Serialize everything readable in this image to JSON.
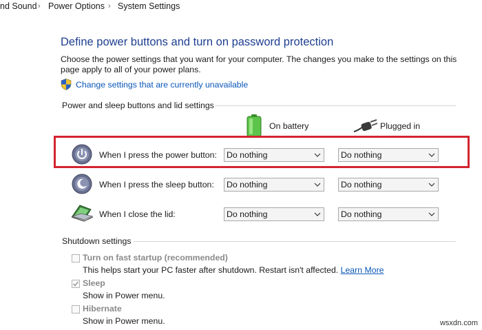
{
  "breadcrumb": {
    "item1": "nd Sound",
    "item2": "Power Options",
    "item3": "System Settings",
    "separator": "›"
  },
  "page": {
    "title": "Define power buttons and turn on password protection",
    "description": "Choose the power settings that you want for your computer. The changes you make to the settings on this page apply to all of your power plans.",
    "change_link": "Change settings that are currently unavailable"
  },
  "power_section": {
    "title": "Power and sleep buttons and lid settings",
    "col_battery": "On battery",
    "col_plugged": "Plugged in",
    "rows": [
      {
        "label": "When I press the power button:",
        "battery": "Do nothing",
        "plugged": "Do nothing"
      },
      {
        "label": "When I press the sleep button:",
        "battery": "Do nothing",
        "plugged": "Do nothing"
      },
      {
        "label": "When I close the lid:",
        "battery": "Do nothing",
        "plugged": "Do nothing"
      }
    ]
  },
  "shutdown_section": {
    "title": "Shutdown settings",
    "items": [
      {
        "label": "Turn on fast startup (recommended)",
        "help": "This helps start your PC faster after shutdown. Restart isn't affected.",
        "help_link": "Learn More",
        "checked": false
      },
      {
        "label": "Sleep",
        "help": "Show in Power menu.",
        "checked": true
      },
      {
        "label": "Hibernate",
        "help": "Show in Power menu.",
        "checked": false
      }
    ]
  },
  "watermark": "wsxdn.com",
  "colors": {
    "title_blue": "#1e3f8f",
    "link_blue": "#0a56b8",
    "highlight_red": "#d3242f"
  }
}
